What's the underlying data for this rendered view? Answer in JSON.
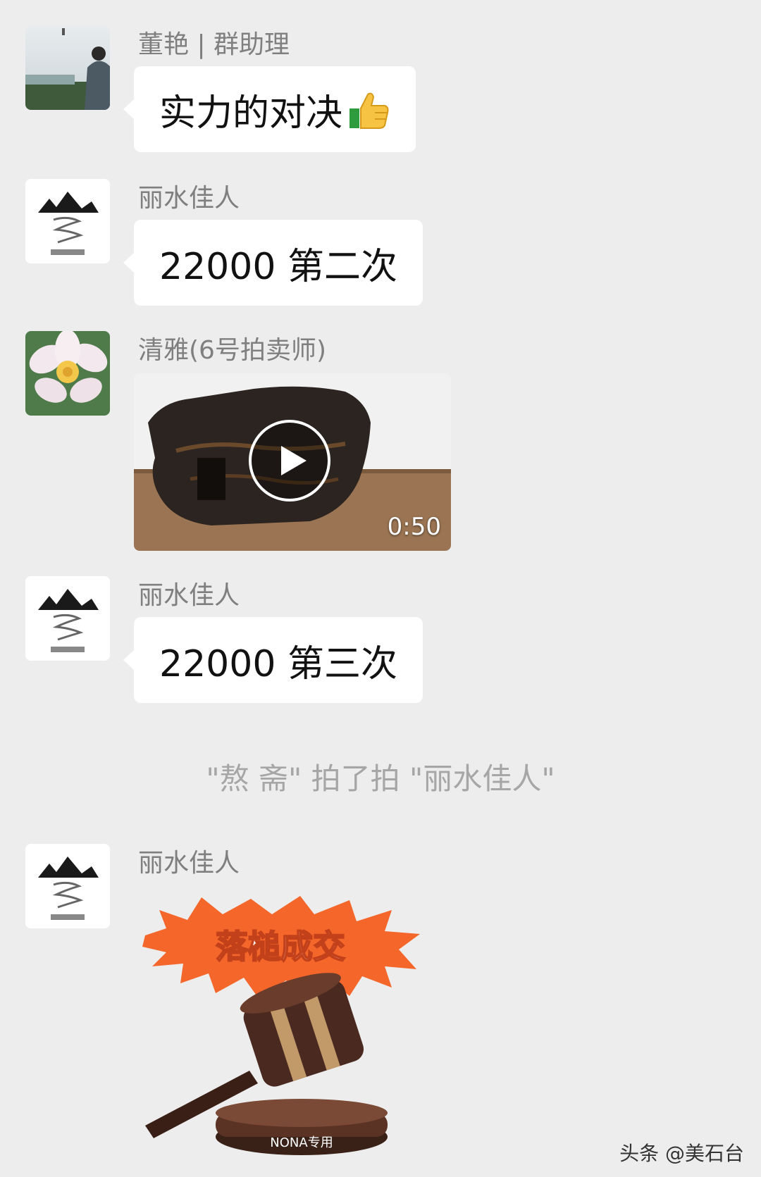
{
  "messages": [
    {
      "sender": "董艳 | 群助理",
      "text": "实力的对决",
      "emoji": "thumbs-up-icon"
    },
    {
      "sender": "丽水佳人",
      "text": "22000 第二次"
    },
    {
      "sender": "清雅(6号拍卖师)",
      "video": {
        "duration": "0:50"
      }
    },
    {
      "sender": "丽水佳人",
      "text": "22000 第三次"
    },
    {
      "sender": "丽水佳人",
      "sticker": {
        "title": "落槌成交",
        "label": "NONA专用"
      }
    }
  ],
  "system_message": "\"熬  斋\" 拍了拍 \"丽水佳人\"",
  "watermark": "头条 @美石台",
  "colors": {
    "background": "#ededed",
    "bubble": "#ffffff",
    "sender_name": "#7f7f7f",
    "system_text": "#a6a6a6",
    "sticker_burst": "#f4662a"
  }
}
